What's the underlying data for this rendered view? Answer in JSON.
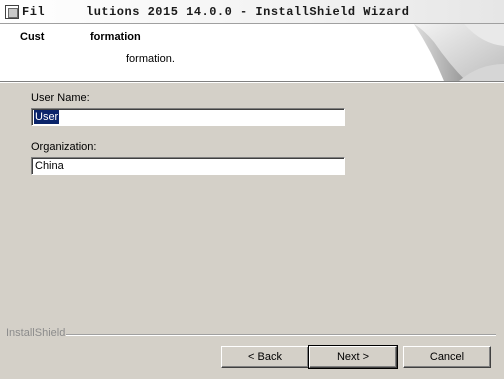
{
  "window": {
    "title_left": "Fil",
    "title_right": "lutions 2015 14.0.0 - InstallShield Wizard"
  },
  "header": {
    "title_left": "Cust",
    "title_right": "formation",
    "description": "formation."
  },
  "form": {
    "user_name": {
      "label": "User Name:",
      "value": "User"
    },
    "organization": {
      "label": "Organization:",
      "value": "China"
    }
  },
  "footer": {
    "brand": "InstallShield",
    "back_label": "< Back",
    "next_label": "Next >",
    "cancel_label": "Cancel"
  }
}
